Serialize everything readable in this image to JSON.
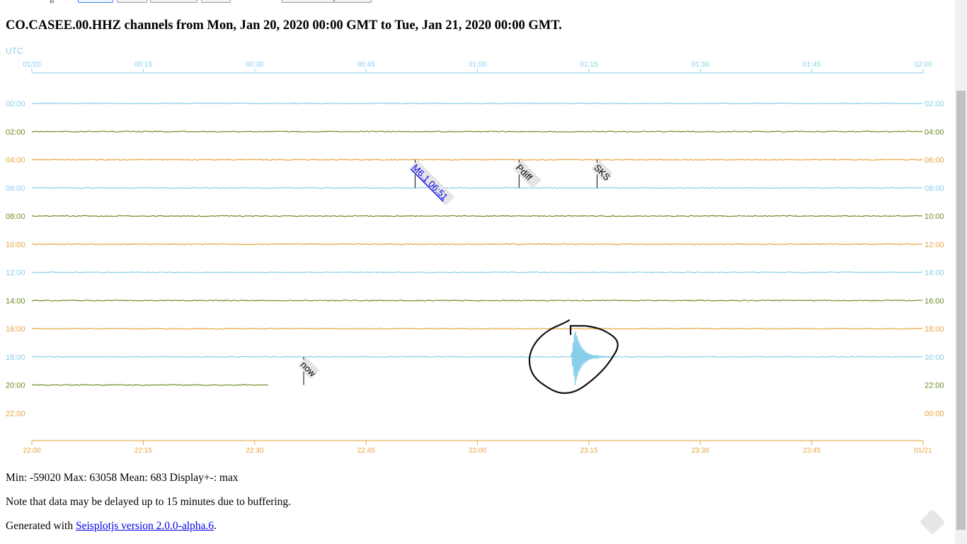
{
  "title": "CO.CASEE.00.HHZ channels from Mon, Jan 20, 2020 00:00 GMT to Tue, Jan 21, 2020 00:00 GMT.",
  "colors": {
    "blue": "#87ceeb",
    "green": "#6b8e23",
    "orange": "#e8a33d",
    "marker_bg": "#e4e4e4",
    "link": "#0000ee"
  },
  "chart_data": {
    "type": "line",
    "axis_label": "UTC",
    "top_axis": {
      "ticks": [
        "01/20",
        "00:15",
        "00:30",
        "00:45",
        "01:00",
        "01:15",
        "01:30",
        "01:45",
        "02:00"
      ]
    },
    "bottom_axis": {
      "ticks": [
        "22:00",
        "22:15",
        "22:30",
        "22:45",
        "23:00",
        "23:15",
        "23:30",
        "23:45",
        "01/21"
      ]
    },
    "xlim_minutes": [
      0,
      120
    ],
    "rows": [
      {
        "left": "00:00",
        "right": "02:00",
        "color": "blue",
        "end_minute": 120
      },
      {
        "left": "02:00",
        "right": "04:00",
        "color": "green",
        "end_minute": 120
      },
      {
        "left": "04:00",
        "right": "06:00",
        "color": "orange",
        "end_minute": 120
      },
      {
        "left": "06:00",
        "right": "08:00",
        "color": "blue",
        "end_minute": 120
      },
      {
        "left": "08:00",
        "right": "10:00",
        "color": "green",
        "end_minute": 120
      },
      {
        "left": "10:00",
        "right": "12:00",
        "color": "orange",
        "end_minute": 120
      },
      {
        "left": "12:00",
        "right": "14:00",
        "color": "blue",
        "end_minute": 120
      },
      {
        "left": "14:00",
        "right": "16:00",
        "color": "green",
        "end_minute": 120
      },
      {
        "left": "16:00",
        "right": "18:00",
        "color": "orange",
        "end_minute": 120
      },
      {
        "left": "18:00",
        "right": "20:00",
        "color": "blue",
        "end_minute": 120
      },
      {
        "left": "20:00",
        "right": "22:00",
        "color": "green",
        "end_minute": 32
      },
      {
        "left": "22:00",
        "right": "00:00",
        "color": "orange",
        "end_minute": 0
      }
    ],
    "markers": [
      {
        "label": "M6.1 06:51",
        "row": 2,
        "minute": 51.6,
        "link": true
      },
      {
        "label": "Pdiff",
        "row": 2,
        "minute": 65.6,
        "link": false
      },
      {
        "label": "SKS",
        "row": 2,
        "minute": 76.1,
        "link": false
      },
      {
        "label": "now",
        "row": 9,
        "minute": 36.6,
        "link": false
      }
    ],
    "event_minute": 73.2,
    "event_row": 9,
    "stats": {
      "min": -59020,
      "max": 63058,
      "mean": 683,
      "display": "max"
    }
  },
  "footer": {
    "stats_line": "Min: -59020 Max: 63058 Mean: 683 Display+-: max",
    "note": "Note that data may be delayed up to 15 minutes due to buffering.",
    "generated_prefix": "Generated with ",
    "generated_link": "Seisplotjs version 2.0.0-alpha.6",
    "generated_suffix": "."
  }
}
